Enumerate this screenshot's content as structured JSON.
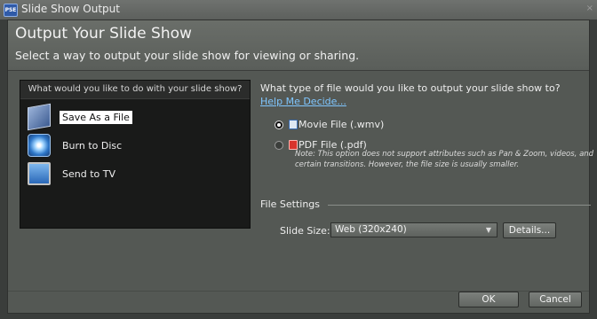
{
  "window": {
    "title": "Slide Show Output",
    "app_icon_text": "PSE",
    "close_glyph": "×"
  },
  "header": {
    "title": "Output Your Slide Show",
    "subtitle": "Select a way to output your slide show for viewing or sharing."
  },
  "left_panel": {
    "heading": "What would you like to do with your slide show?",
    "options": [
      {
        "label": "Save As a File",
        "icon": "file-icon",
        "selected": true
      },
      {
        "label": "Burn to Disc",
        "icon": "disc-icon",
        "selected": false
      },
      {
        "label": "Send to TV",
        "icon": "tv-icon",
        "selected": false
      }
    ]
  },
  "right_panel": {
    "question": "What type of file would you like to output your slide show to?",
    "help_link": "Help Me Decide...",
    "file_types": [
      {
        "label": "Movie File (.wmv)",
        "icon": "wmv-file-icon",
        "selected": true
      },
      {
        "label": "PDF File (.pdf)",
        "icon": "pdf-file-icon",
        "selected": false
      }
    ],
    "pdf_note": "Note: This option does not support attributes such as Pan & Zoom, videos, and certain transitions. However, the file size is usually smaller.",
    "file_settings": {
      "title": "File Settings",
      "slide_size_label": "Slide Size:",
      "slide_size_value": "Web (320x240)",
      "details_button": "Details..."
    }
  },
  "footer": {
    "ok": "OK",
    "cancel": "Cancel"
  }
}
